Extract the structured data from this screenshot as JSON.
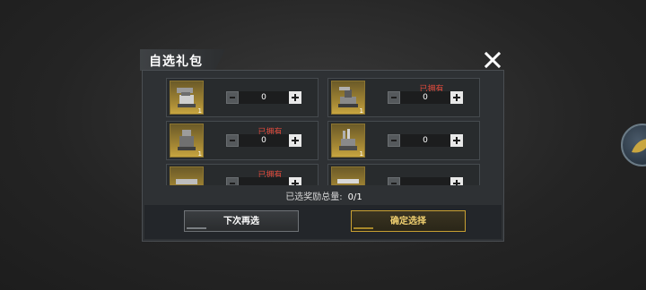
{
  "dialog": {
    "title": "自选礼包",
    "summary_label": "已选奖励总量:",
    "summary_value": "0/1"
  },
  "items": [
    {
      "name": "item-1",
      "count": "1",
      "owned": "",
      "qty": "0"
    },
    {
      "name": "item-2",
      "count": "1",
      "owned": "已拥有",
      "qty": "0"
    },
    {
      "name": "item-3",
      "count": "1",
      "owned": "已拥有",
      "qty": "0"
    },
    {
      "name": "item-4",
      "count": "1",
      "owned": "",
      "qty": "0"
    },
    {
      "name": "item-5",
      "count": "",
      "owned": "已拥有",
      "qty": ""
    },
    {
      "name": "item-6",
      "count": "",
      "owned": "",
      "qty": ""
    }
  ],
  "buttons": {
    "retry": "下次再选",
    "confirm": "确定选择"
  },
  "colors": {
    "owned_text": "#e04a3c",
    "confirm_border": "#c8a032",
    "icon_gold": "#a88a35"
  }
}
